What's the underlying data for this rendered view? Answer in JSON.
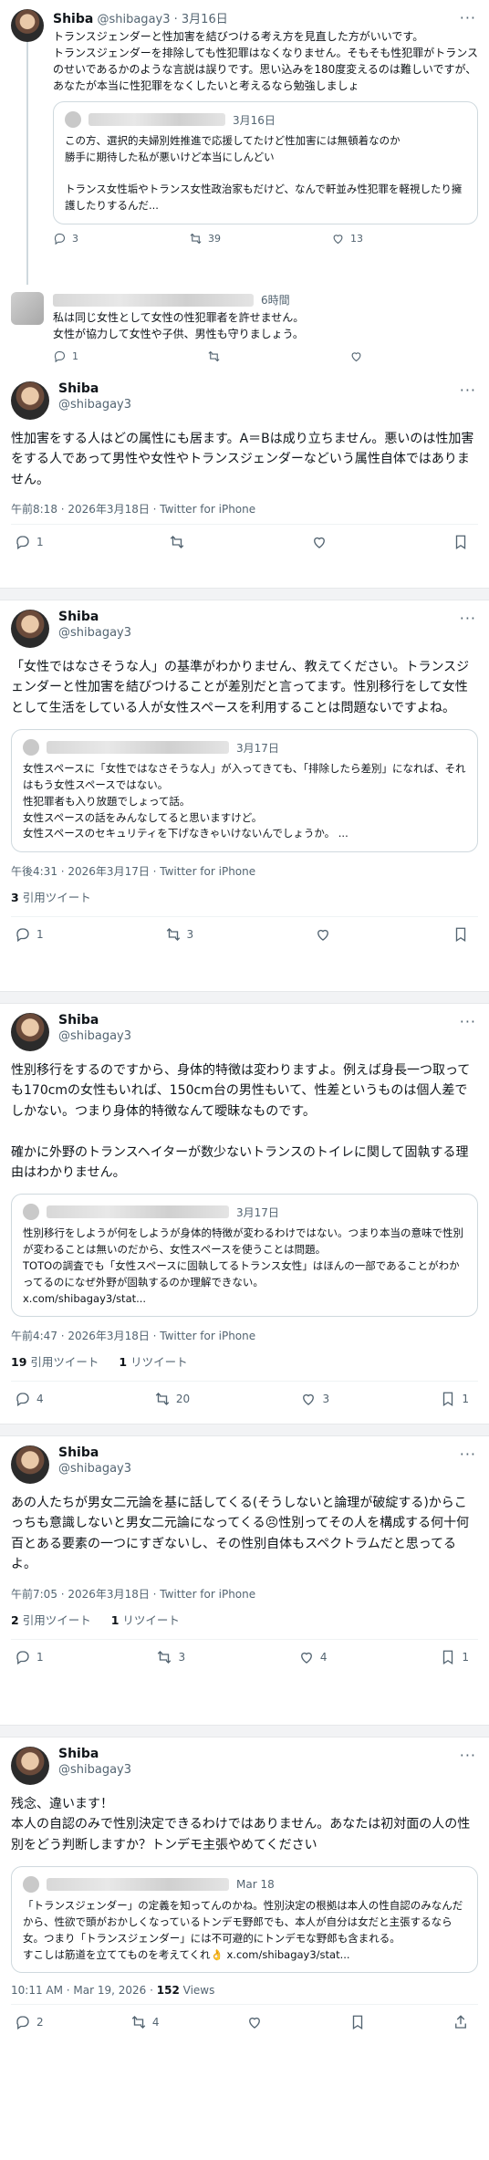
{
  "icons": {
    "reply": "reply-icon",
    "retweet": "retweet-icon",
    "like": "heart-icon",
    "bookmark": "bookmark-icon",
    "share": "share-icon",
    "more": "more-icon"
  },
  "top_post": {
    "name": "Shiba",
    "handle": "@shibagay3",
    "date": "· 3月16日",
    "text": "トランスジェンダーと性加害を結びつける考え方を見直した方がいいです。\nトランスジェンダーを排除しても性犯罪はなくなりません。そもそも性犯罪がトランスのせいであるかのような言説は誤りです。思い込みを180度変えるのは難しいですが、あなたが本当に性犯罪をなくしたいと考えるなら勉強しましょ",
    "quote_date": "3月16日",
    "quote_text": "この方、選択的夫婦別姓推進で応援してたけど性加害には無頓着なのか\n勝手に期待した私が悪いけど本当にしんどい\n\nトランス女性垢やトランス女性政治家もだけど、なんで軒並み性犯罪を軽視したり擁護したりするんだ...",
    "replies": "3",
    "retweets": "39",
    "likes": "13"
  },
  "reply_post": {
    "time": "6時間",
    "text": "私は同じ女性として女性の性犯罪者を許せません。\n女性が協力して女性や子供、男性も守りましょう。",
    "replies": "1"
  },
  "posts": [
    {
      "name": "Shiba",
      "handle": "@shibagay3",
      "text": "性加害をする人はどの属性にも居ます。A＝Bは成り立ちません。悪いのは性加害をする人であって男性や女性やトランスジェンダーなどいう属性自体ではありません。",
      "meta": "午前8:18 · 2026年3月18日 · Twitter for iPhone",
      "replies": "1",
      "retweets": "",
      "likes": "",
      "bookmarks": ""
    },
    {
      "name": "Shiba",
      "handle": "@shibagay3",
      "text": "「女性ではなさそうな人」の基準がわかりません、教えてください。トランスジェンダーと性加害を結びつけることが差別だと言ってます。性別移行をして女性として生活をしている人が女性スペースを利用することは問題ないですよね。",
      "quote_date": "3月17日",
      "quote_text": "女性スペースに「女性ではなさそうな人」が入ってきても、「排除したら差別」になれば、それはもう女性スペースではない。\n性犯罪者も入り放題でしょって話。\n女性スペースの話をみんなしてると思いますけど。\n女性スペースのセキュリティを下げなきゃいけないんでしょうか。 ...",
      "meta": "午後4:31 · 2026年3月17日 · Twitter for iPhone",
      "quote_count": "3",
      "quote_label": "引用ツイート",
      "replies": "1",
      "retweets": "3",
      "likes": "",
      "bookmarks": ""
    },
    {
      "name": "Shiba",
      "handle": "@shibagay3",
      "text": "性別移行をするのですから、身体的特徴は変わりますよ。例えば身長一つ取っても170cmの女性もいれば、150cm台の男性もいて、性差というものは個人差でしかない。つまり身体的特徴なんて曖昧なものです。\n\n確かに外野のトランスヘイターが数少ないトランスのトイレに関して固執する理由はわかりません。",
      "quote_date": "3月17日",
      "quote_text": "性別移行をしようが何をしようが身体的特徴が変わるわけではない。つまり本当の意味で性別が変わることは無いのだから、女性スペースを使うことは問題。\nTOTOの調査でも「女性スペースに固執してるトランス女性」はほんの一部であることがわかってるのになぜ外野が固執するのか理解できない。\nx.com/shibagay3/stat...",
      "meta": "午前4:47 · 2026年3月18日 · Twitter for iPhone",
      "quote_count": "19",
      "quote_label": "引用ツイート",
      "rt_count": "1",
      "rt_label": "リツイート",
      "replies": "4",
      "retweets": "20",
      "likes": "3",
      "bookmarks": "1"
    },
    {
      "name": "Shiba",
      "handle": "@shibagay3",
      "text": "あの人たちが男女二元論を基に話してくる(そうしないと論理が破綻する)からこっちも意識しないと男女二元論になってくる😣性別ってその人を構成する何十何百とある要素の一つにすぎないし、その性別自体もスペクトラムだと思ってるよ。",
      "meta": "午前7:05 · 2026年3月18日 · Twitter for iPhone",
      "quote_count": "2",
      "quote_label": "引用ツイート",
      "rt_count": "1",
      "rt_label": "リツイート",
      "replies": "1",
      "retweets": "3",
      "likes": "4",
      "bookmarks": "1"
    },
    {
      "name": "Shiba",
      "handle": "@shibagay3",
      "text": "残念、違います！\n本人の自認のみで性別決定できるわけではありません。あなたは初対面の人の性別をどう判断しますか？トンデモ主張やめてください",
      "quote_date": "Mar 18",
      "quote_text": "「トランスジェンダー」の定義を知ってんのかね。性別決定の根拠は本人の性自認のみなんだから、性欲で頭がおかしくなっているトンデモ野郎でも、本人が自分は女だと主張するなら女。つまり「トランスジェンダー」には不可避的にトンデモな野郎も含まれる。\nすこしは筋道を立ててものを考えてくれ👌 x.com/shibagay3/stat...",
      "meta_prefix": "10:11 AM · Mar 19, 2026 · ",
      "views": "152",
      "views_label": "Views",
      "replies": "2",
      "retweets": "4",
      "likes": "",
      "bookmarks": ""
    }
  ]
}
